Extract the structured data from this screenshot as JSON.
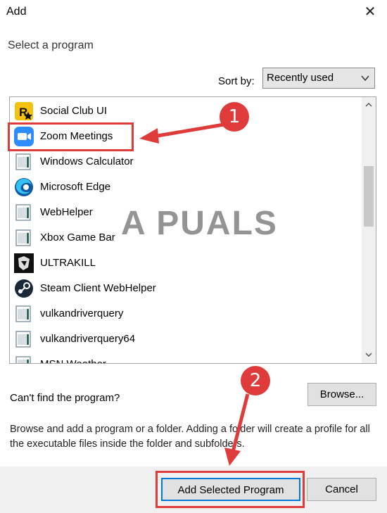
{
  "window": {
    "title": "Add",
    "close_glyph": "✕"
  },
  "subtitle": "Select a program",
  "sort": {
    "label": "Sort by:",
    "selected": "Recently used"
  },
  "programs": [
    {
      "name": "Social Club UI",
      "icon": "rockstar-icon"
    },
    {
      "name": "Zoom Meetings",
      "icon": "zoom-icon"
    },
    {
      "name": "Windows Calculator",
      "icon": "generic-app-icon"
    },
    {
      "name": "Microsoft Edge",
      "icon": "edge-icon"
    },
    {
      "name": "WebHelper",
      "icon": "generic-app-icon"
    },
    {
      "name": "Xbox Game Bar",
      "icon": "generic-app-icon"
    },
    {
      "name": "ULTRAKILL",
      "icon": "ultrakill-icon"
    },
    {
      "name": "Steam Client WebHelper",
      "icon": "steam-icon"
    },
    {
      "name": "vulkandriverquery",
      "icon": "generic-app-icon"
    },
    {
      "name": "vulkandriverquery64",
      "icon": "generic-app-icon"
    },
    {
      "name": "MSN Weather",
      "icon": "generic-app-icon"
    }
  ],
  "cant_find": "Can't find the program?",
  "browse_label": "Browse...",
  "help_text": "Browse and add a program or a folder. Adding a folder will create a profile for all the executable files inside the folder and subfolders.",
  "add_label": "Add Selected Program",
  "cancel_label": "Cancel",
  "annotations": {
    "step1": "1",
    "step2": "2",
    "color": "#e03b3b"
  },
  "watermark": "A PUALS",
  "colors": {
    "accent": "#0078d7",
    "annotation": "#e03b3b"
  }
}
